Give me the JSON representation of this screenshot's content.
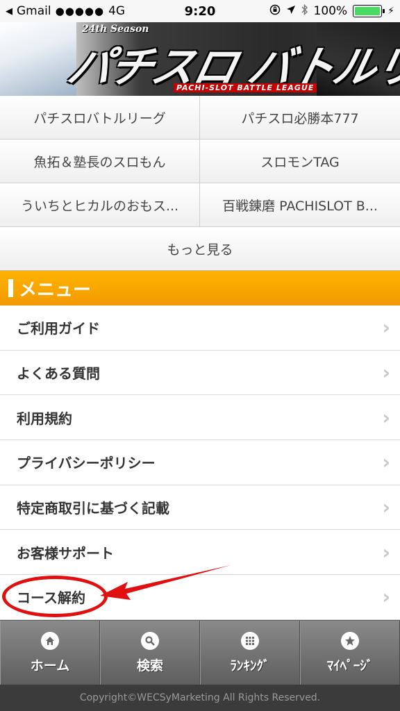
{
  "status_bar": {
    "back_app": "Gmail",
    "signal": "●●●●●",
    "network": "4G",
    "time": "9:20",
    "battery": "100%",
    "battery_level": 1.0
  },
  "banner": {
    "season": "24th Season",
    "title": "パチスロ バトルリーグ",
    "subtitle": "PACHI-SLOT BATTLE LEAGUE"
  },
  "categories": [
    {
      "label": "パチスロバトルリーグ"
    },
    {
      "label": "パチスロ必勝本777"
    },
    {
      "label": "魚拓＆塾長のスロもん"
    },
    {
      "label": "スロモンTAG"
    },
    {
      "label": "ういちとヒカルのおもス..."
    },
    {
      "label": "百戦錬磨 PACHISLOT B..."
    }
  ],
  "more_label": "もっと見る",
  "menu": {
    "title": "メニュー",
    "items": [
      {
        "label": "ご利用ガイド"
      },
      {
        "label": "よくある質問"
      },
      {
        "label": "利用規約"
      },
      {
        "label": "プライバシーポリシー"
      },
      {
        "label": "特定商取引に基づく記載"
      },
      {
        "label": "お客様サポート"
      },
      {
        "label": "コース解約"
      }
    ]
  },
  "bottom_nav": [
    {
      "label": "ホーム",
      "icon": "home-icon"
    },
    {
      "label": "検索",
      "icon": "search-icon"
    },
    {
      "label": "ﾗﾝｷﾝｸﾞ",
      "icon": "grid-icon"
    },
    {
      "label": "ﾏｲﾍﾟｰｼﾞ",
      "icon": "star-icon"
    }
  ],
  "footer": {
    "copyright": "Copyright©WECSyMarketing All Rights Reserved."
  },
  "colors": {
    "menu_header": "#f7a400",
    "annotation": "#e01010",
    "battery": "#4cd964"
  }
}
